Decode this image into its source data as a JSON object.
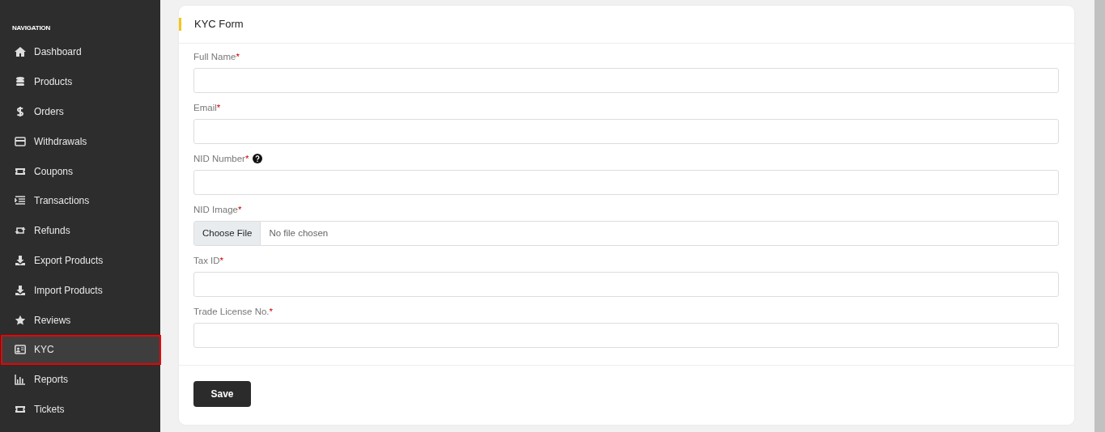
{
  "sidebar": {
    "heading": "NAVIGATION",
    "items": [
      {
        "label": "Dashboard",
        "selected": false
      },
      {
        "label": "Products",
        "selected": false
      },
      {
        "label": "Orders",
        "selected": false
      },
      {
        "label": "Withdrawals",
        "selected": false
      },
      {
        "label": "Coupons",
        "selected": false
      },
      {
        "label": "Transactions",
        "selected": false
      },
      {
        "label": "Refunds",
        "selected": false
      },
      {
        "label": "Export Products",
        "selected": false
      },
      {
        "label": "Import Products",
        "selected": false
      },
      {
        "label": "Reviews",
        "selected": false
      },
      {
        "label": "KYC",
        "selected": true
      },
      {
        "label": "Reports",
        "selected": false
      },
      {
        "label": "Tickets",
        "selected": false
      }
    ]
  },
  "form": {
    "title": "KYC Form",
    "fields": [
      {
        "label": "Full Name",
        "required_mark": "*",
        "kind": "text"
      },
      {
        "label": "Email",
        "required_mark": "*",
        "kind": "text"
      },
      {
        "label": "NID Number",
        "required_mark": "*",
        "kind": "text",
        "help": true
      },
      {
        "label": "NID Image",
        "required_mark": "*",
        "kind": "file",
        "button": "Choose File",
        "status": "No file chosen"
      },
      {
        "label": "Tax ID",
        "required_mark": "*",
        "kind": "text"
      },
      {
        "label": "Trade License No.",
        "required_mark": "*",
        "kind": "text"
      }
    ],
    "submit": "Save"
  }
}
